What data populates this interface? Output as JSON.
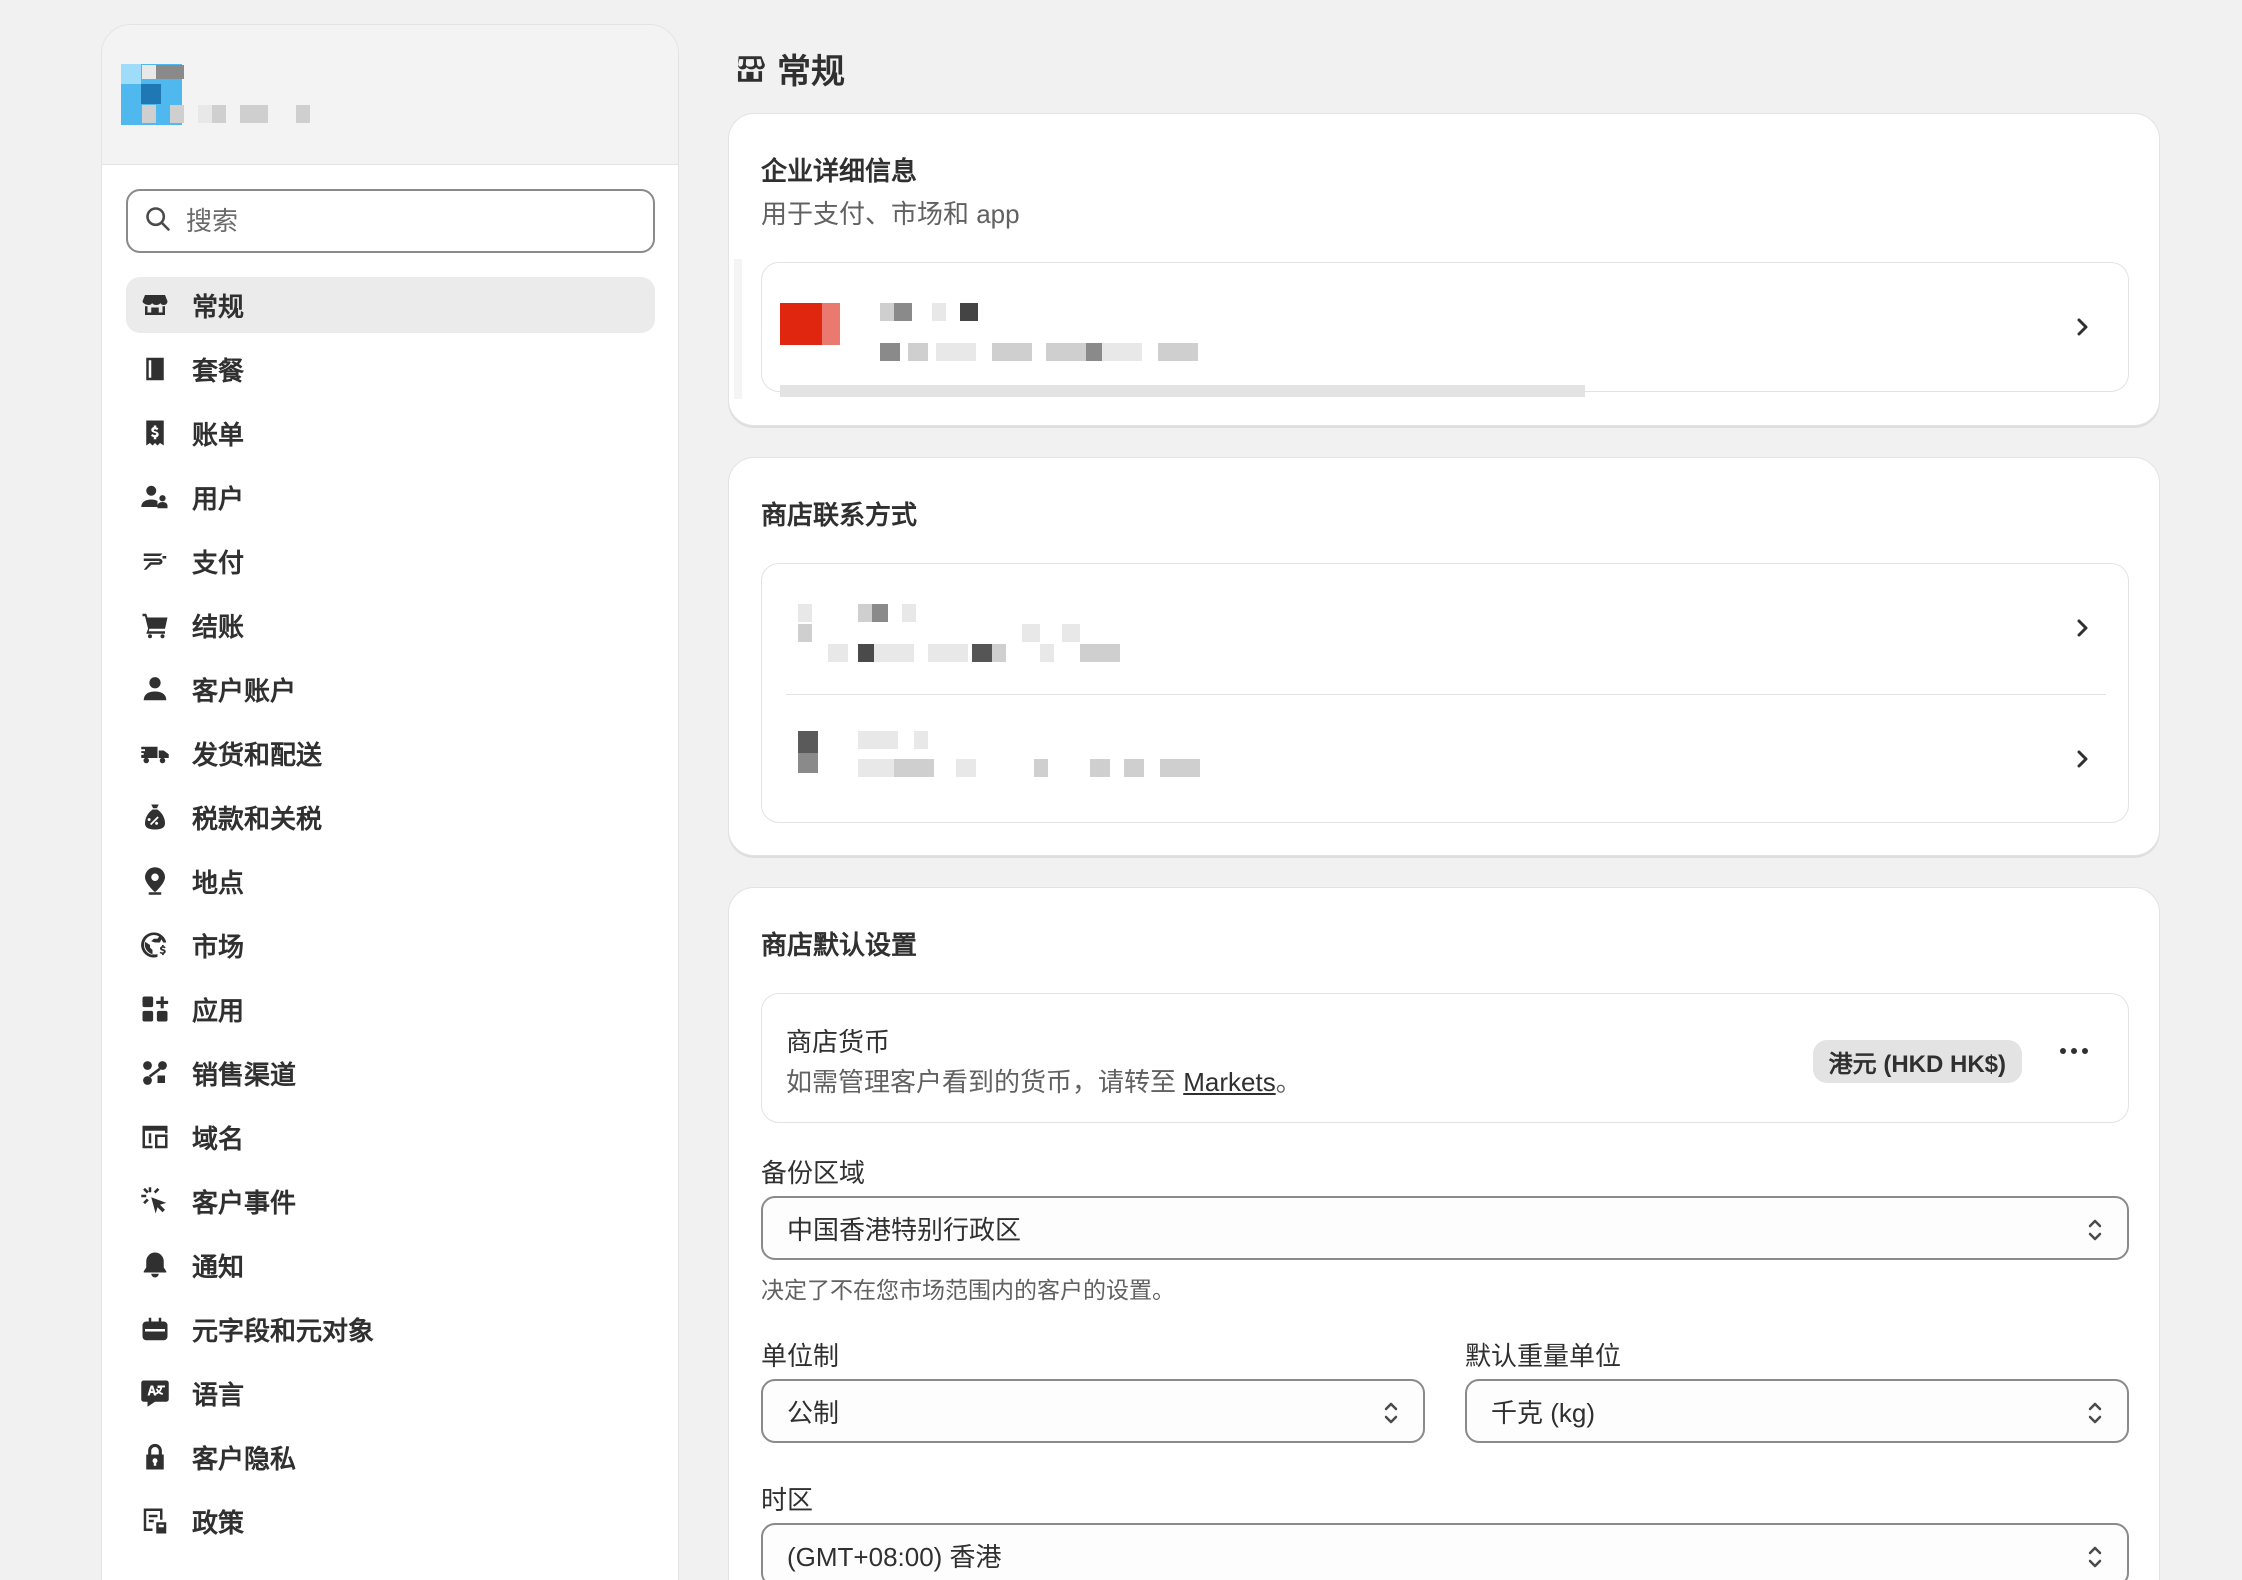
{
  "sidebar": {
    "search": {
      "placeholder": "搜索"
    },
    "items": [
      {
        "label": "常规",
        "icon": "store-icon",
        "active": true
      },
      {
        "label": "套餐",
        "icon": "plan-icon"
      },
      {
        "label": "账单",
        "icon": "receipt-dollar-icon"
      },
      {
        "label": "用户",
        "icon": "users-icon"
      },
      {
        "label": "支付",
        "icon": "payment-hand-icon"
      },
      {
        "label": "结账",
        "icon": "cart-icon"
      },
      {
        "label": "客户账户",
        "icon": "person-icon"
      },
      {
        "label": "发货和配送",
        "icon": "delivery-truck-icon"
      },
      {
        "label": "税款和关税",
        "icon": "tax-bag-icon"
      },
      {
        "label": "地点",
        "icon": "location-pin-icon"
      },
      {
        "label": "市场",
        "icon": "globe-dollar-icon"
      },
      {
        "label": "应用",
        "icon": "apps-grid-icon"
      },
      {
        "label": "销售渠道",
        "icon": "channels-icon"
      },
      {
        "label": "域名",
        "icon": "domain-icon"
      },
      {
        "label": "客户事件",
        "icon": "cursor-click-icon"
      },
      {
        "label": "通知",
        "icon": "bell-icon"
      },
      {
        "label": "元字段和元对象",
        "icon": "metafields-icon"
      },
      {
        "label": "语言",
        "icon": "translate-icon"
      },
      {
        "label": "客户隐私",
        "icon": "lock-icon"
      },
      {
        "label": "政策",
        "icon": "policy-icon"
      }
    ]
  },
  "page": {
    "title": "常规",
    "icon": "store-icon"
  },
  "business_details": {
    "title": "企业详细信息",
    "subtitle": "用于支付、市场和 app"
  },
  "contact": {
    "title": "商店联系方式"
  },
  "defaults": {
    "title": "商店默认设置",
    "currency": {
      "label": "商店货币",
      "description_prefix": "如需管理客户看到的货币，请转至 ",
      "description_link": "Markets",
      "description_suffix": "。",
      "badge": "港元 (HKD HK$)"
    },
    "backup_region": {
      "label": "备份区域",
      "value": "中国香港特别行政区",
      "help": "决定了不在您市场范围内的客户的设置。"
    },
    "unit_system": {
      "label": "单位制",
      "value": "公制"
    },
    "weight_unit": {
      "label": "默认重量单位",
      "value": "千克 (kg)"
    },
    "timezone": {
      "label": "时区",
      "value": "(GMT+08:00) 香港"
    }
  },
  "colors": {
    "background": "#f1f1f1",
    "card": "#ffffff",
    "active_nav": "#ebebeb",
    "text": "#303030",
    "muted": "#616161"
  }
}
